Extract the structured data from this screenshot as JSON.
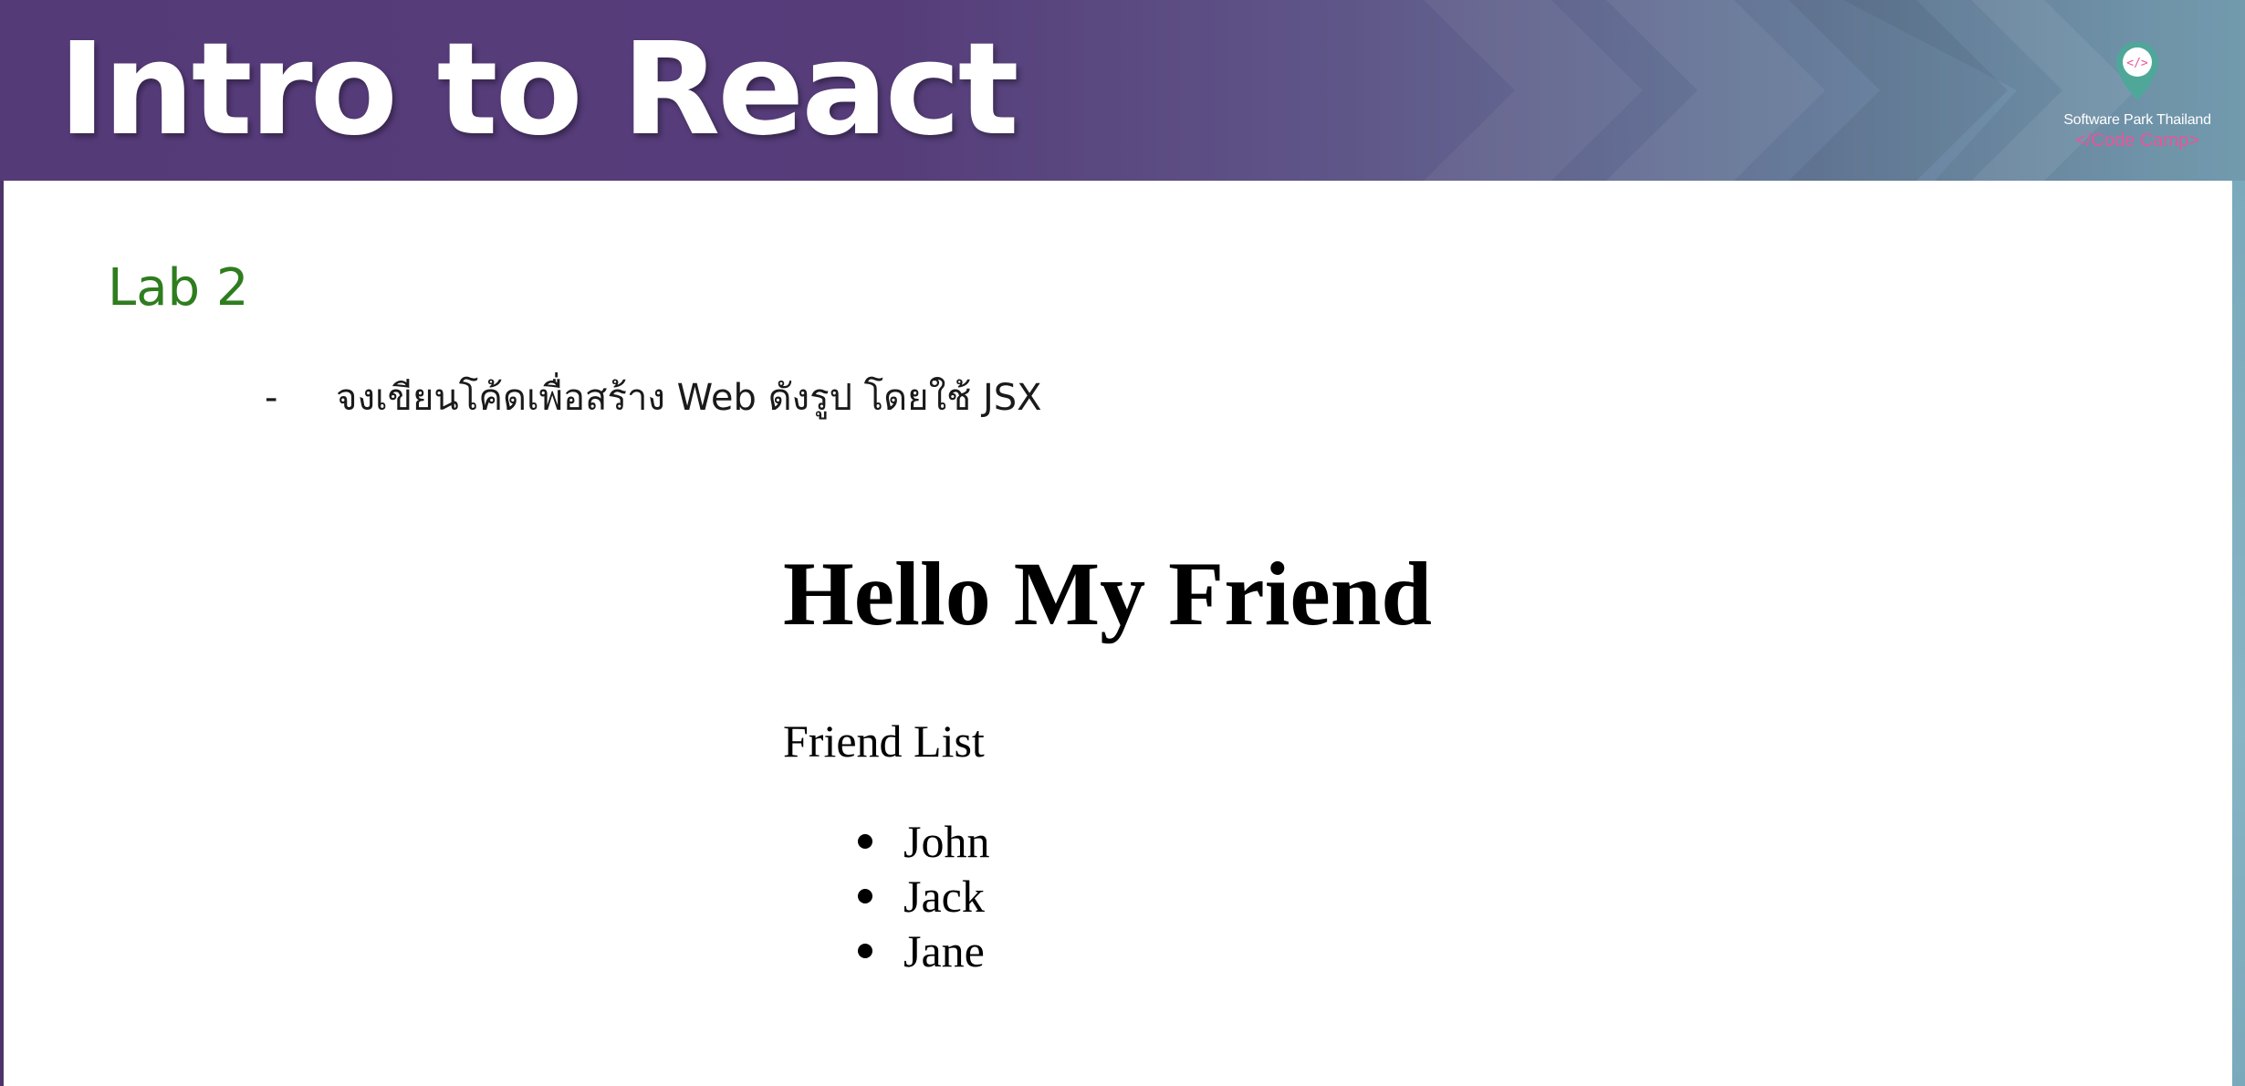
{
  "header": {
    "title": "Intro to React",
    "logo": {
      "icon": "code-location-pin-icon",
      "icon_glyph": "</>",
      "company": "Software Park Thailand",
      "product": "</Code Camp>"
    }
  },
  "content": {
    "heading": "Lab 2",
    "bullets": [
      {
        "marker": "-",
        "text": "จงเขียนโค้ดเพื่อสร้าง Web ดังรูป โดยใช้ JSX"
      }
    ]
  },
  "example_output": {
    "heading": "Hello My Friend",
    "subheading": "Friend List",
    "friends": [
      "John",
      "Jack",
      "Jane"
    ]
  },
  "colors": {
    "banner_purple": "#553a78",
    "banner_teal": "#79a4b8",
    "heading_green": "#2e7d1f",
    "logo_pink": "#e8559a",
    "logo_teal": "#4fa79a"
  }
}
